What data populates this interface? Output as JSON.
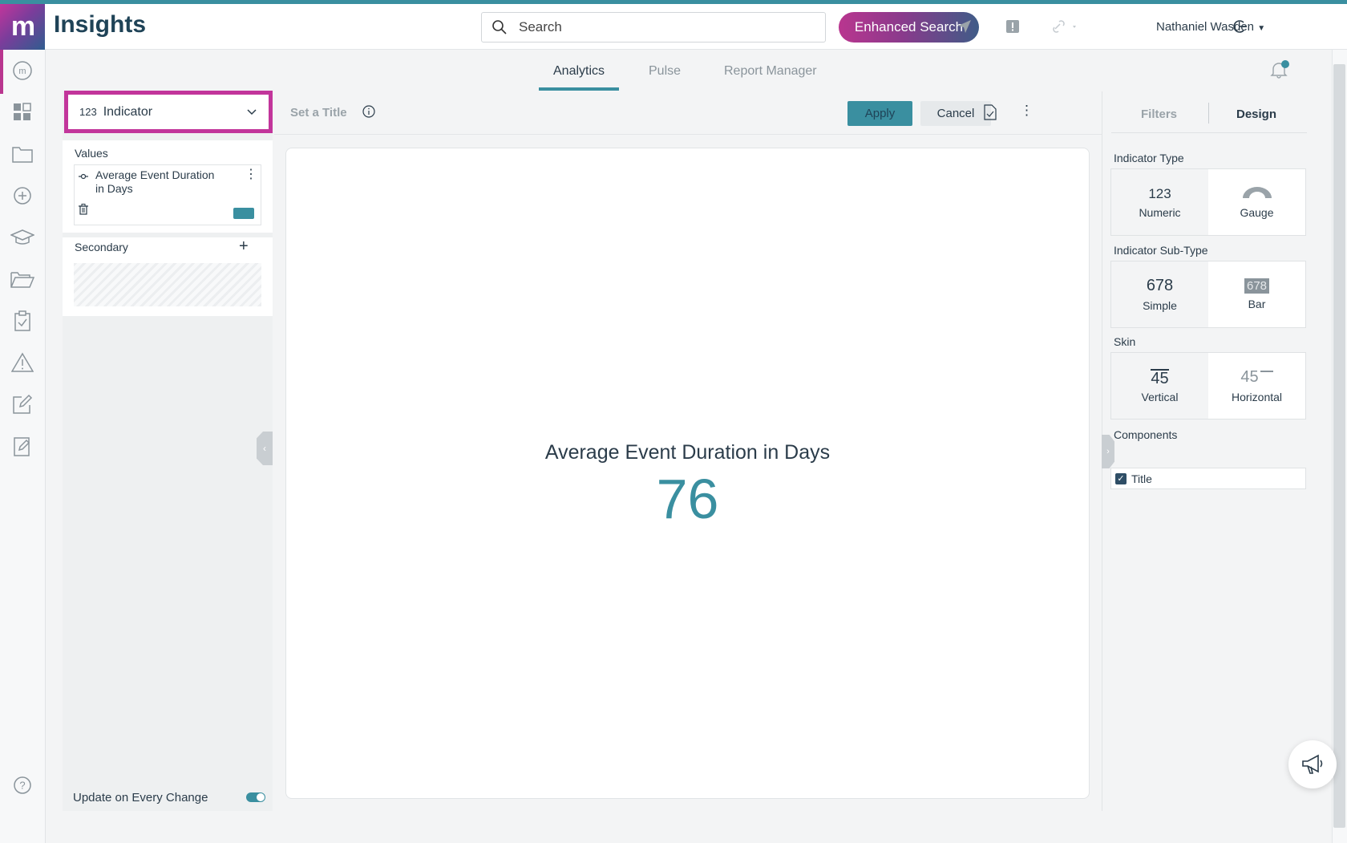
{
  "header": {
    "app_title": "Insights",
    "logo_text": "m",
    "search_placeholder": "Search",
    "enhanced_search": "Enhanced Search",
    "user_name": "Nathaniel Wasden"
  },
  "tabs": [
    "Analytics",
    "Pulse",
    "Report Manager"
  ],
  "active_tab": "Analytics",
  "left_panel": {
    "viz_prefix": "123",
    "viz_type": "Indicator",
    "values_label": "Values",
    "value_item": "Average Event Duration in Days",
    "secondary_label": "Secondary",
    "update_label": "Update on Every Change"
  },
  "toolbar": {
    "title_placeholder": "Set a Title",
    "apply": "Apply",
    "cancel": "Cancel"
  },
  "widget": {
    "title": "Average Event Duration in Days",
    "value": "76"
  },
  "right_panel": {
    "tab_filters": "Filters",
    "tab_design": "Design",
    "indicator_type_label": "Indicator Type",
    "type_numeric_top": "123",
    "type_numeric": "Numeric",
    "type_gauge": "Gauge",
    "subtype_label": "Indicator Sub-Type",
    "subtype_simple_top": "678",
    "subtype_simple": "Simple",
    "subtype_bar_top": "678",
    "subtype_bar": "Bar",
    "skin_label": "Skin",
    "skin_vertical_top": "45",
    "skin_vertical": "Vertical",
    "skin_horizontal_top": "45",
    "skin_horizontal": "Horizontal",
    "components_label": "Components",
    "component_title": "Title"
  },
  "colors": {
    "accent": "#3a8fa0",
    "brand_magenta": "#c2359b",
    "navy": "#1f4357"
  }
}
